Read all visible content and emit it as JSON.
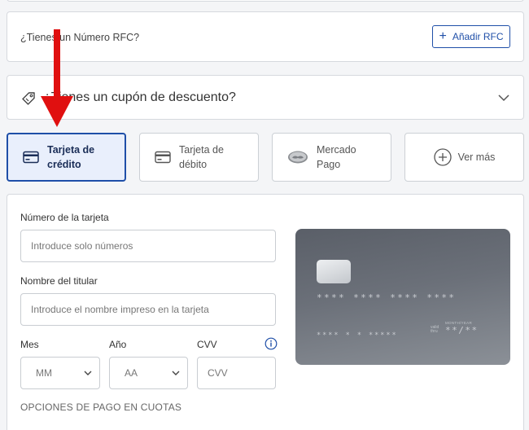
{
  "rfc": {
    "question": "¿Tienes un Número RFC?",
    "add_button": "Añadir RFC"
  },
  "coupon": {
    "label": "¿Tienes un cupón de descuento?"
  },
  "payment_methods": [
    {
      "label": "Tarjeta de crédito",
      "line1": "Tarjeta de",
      "line2": "crédito",
      "icon": "credit-card-icon",
      "selected": true
    },
    {
      "label": "Tarjeta de débito",
      "line1": "Tarjeta de",
      "line2": "débito",
      "icon": "debit-card-icon",
      "selected": false
    },
    {
      "label": "Mercado Pago",
      "line1": "Mercado",
      "line2": "Pago",
      "icon": "mercado-pago-icon",
      "selected": false
    },
    {
      "label": "Ver más",
      "icon": "plus-circle-icon",
      "selected": false
    }
  ],
  "form": {
    "card_number_label": "Número de la tarjeta",
    "card_number_placeholder": "Introduce solo números",
    "holder_label": "Nombre del titular",
    "holder_placeholder": "Introduce el nombre impreso en la tarjeta",
    "month_label": "Mes",
    "month_value": "MM",
    "year_label": "Año",
    "year_value": "AA",
    "cvv_label": "CVV",
    "cvv_placeholder": "CVV",
    "installments_label": "OPCIONES DE PAGO EN CUOTAS"
  },
  "card_preview": {
    "number": "**** **** **** ****",
    "holder": "**** * * *****",
    "valid_thru": "valid thru",
    "exp_label": "MONTH/YEAR",
    "expiry": "**/**"
  },
  "colors": {
    "accent": "#1f4fa8",
    "selected_bg": "#e9effc",
    "annotation": "#e01010"
  }
}
